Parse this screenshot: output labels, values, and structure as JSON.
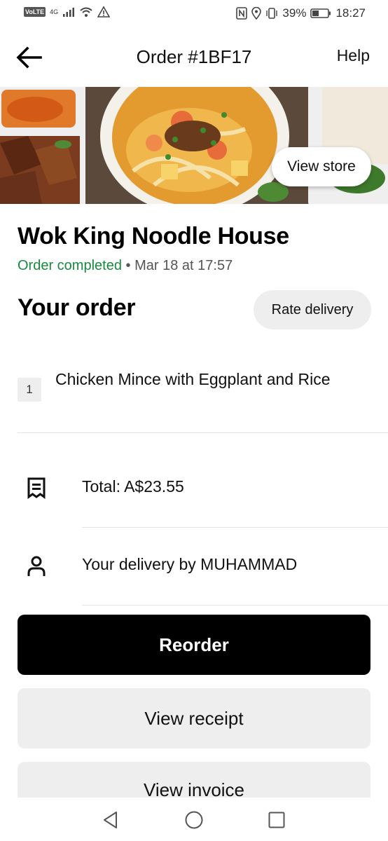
{
  "status_bar": {
    "network": "4G",
    "volte": "VoLTE",
    "battery": "39%",
    "time": "18:27"
  },
  "header": {
    "title": "Order #1BF17",
    "help": "Help",
    "back_icon": "arrow-left-icon"
  },
  "hero": {
    "view_store": "View store"
  },
  "store": {
    "name": "Wok King Noodle House",
    "status": "Order completed",
    "separator": "•",
    "datetime": "Mar 18 at 17:57"
  },
  "order": {
    "heading": "Your order",
    "rate_delivery": "Rate delivery",
    "items": [
      {
        "qty": "1",
        "name": "Chicken Mince with Eggplant and Rice"
      }
    ]
  },
  "info": {
    "total": "Total: A$23.55",
    "delivery": "Your delivery by MUHAMMAD",
    "receipt_icon": "receipt-icon",
    "person_icon": "person-icon"
  },
  "actions": {
    "reorder": "Reorder",
    "view_receipt": "View receipt",
    "view_invoice": "View invoice"
  },
  "colors": {
    "status_green": "#178a3e",
    "primary_button": "#000000",
    "secondary_button": "#eeeeee"
  }
}
